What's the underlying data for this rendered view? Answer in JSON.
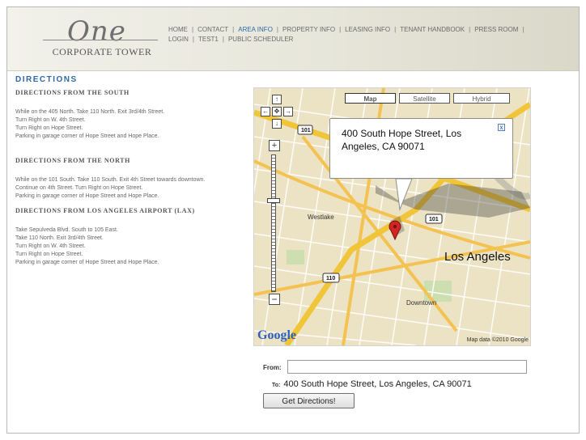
{
  "logo": {
    "script": "One",
    "name": "CORPORATE TOWER"
  },
  "nav": {
    "row1": [
      "HOME",
      "CONTACT",
      "AREA INFO",
      "PROPERTY INFO",
      "LEASING INFO",
      "TENANT HANDBOOK",
      "PRESS ROOM"
    ],
    "row2": [
      "LOGIN",
      "TEST1",
      "PUBLIC SCHEDULER"
    ],
    "active": "AREA INFO"
  },
  "page_title": "DIRECTIONS",
  "sections": [
    {
      "title": "DIRECTIONS FROM THE SOUTH",
      "lines": [
        "While on the 405 North. Take 110 North. Exit 3rd/4th Street.",
        "Turn Right on W. 4th Street.",
        "Turn Right on Hope Street.",
        "Parking in garage corner of Hope Street and Hope Place."
      ]
    },
    {
      "title": "DIRECTIONS FROM THE NORTH",
      "lines": [
        "While on the 101 South. Take 110 South. Exit 4th Street towards downtown.",
        "Continue on 4th Street. Turn Right on Hope Street.",
        "Parking in garage corner of Hope Street and Hope Place."
      ]
    },
    {
      "title": "DIRECTIONS FROM LOS ANGELES AIRPORT (LAX)",
      "lines": [
        "Take Sepulveda Blvd. South to 105 East.",
        "Take 110 North. Exit 3rd/4th Street.",
        "Turn Right on W. 4th Street.",
        "Turn Right on Hope Street.",
        "Parking in garage corner of Hope Street and Hope Place."
      ]
    }
  ],
  "map": {
    "types": [
      "Map",
      "Satellite",
      "Hybrid"
    ],
    "selected_type": "Map",
    "info": "400 South Hope Street, Los Angeles, CA 90071",
    "labels": {
      "city": "Los Angeles",
      "westlake": "Westlake",
      "downtown": "Downtown",
      "shield_101_top": "101",
      "shield_101_mid": "101",
      "shield_110": "110"
    },
    "attribution": "Map data ©2010 Google",
    "google": "Google",
    "colors": {
      "road": "#f3c251",
      "freeway": "#f1c53a",
      "land": "#ece3c4",
      "park": "#cddfb0",
      "pin": "#d42525"
    }
  },
  "form": {
    "from_label": "From:",
    "from_value": "",
    "to_label": "To:",
    "to_value": "400 South Hope Street, Los Angeles, CA 90071",
    "button": "Get Directions!"
  }
}
